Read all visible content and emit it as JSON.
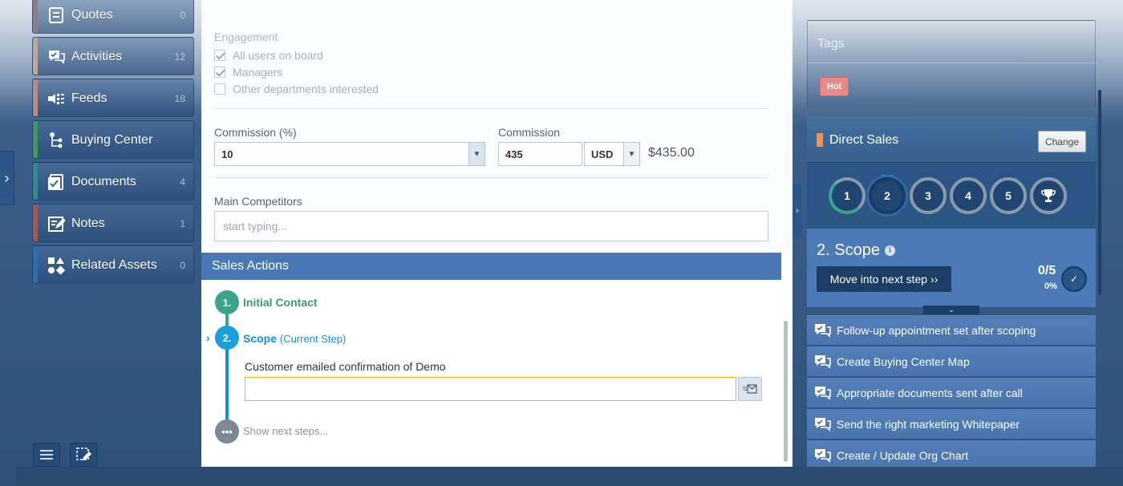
{
  "sidebar": {
    "items": [
      {
        "label": "Quotes",
        "count": "0",
        "accent": "#8b7f86"
      },
      {
        "label": "Activities",
        "count": "12",
        "accent": "#c0a59b"
      },
      {
        "label": "Feeds",
        "count": "18",
        "accent": "#b98b7d"
      },
      {
        "label": "Buying Center",
        "count": "",
        "accent": "#3d9a5f"
      },
      {
        "label": "Documents",
        "count": "4",
        "accent": "#2f8a93"
      },
      {
        "label": "Notes",
        "count": "1",
        "accent": "#a15a4e"
      },
      {
        "label": "Related Assets",
        "count": "0",
        "accent": "#2f6db0"
      }
    ]
  },
  "engagement": {
    "title": "Engagement",
    "options": [
      {
        "label": "All users on board",
        "checked": true
      },
      {
        "label": "Managers",
        "checked": true
      },
      {
        "label": "Other departments interested",
        "checked": false
      }
    ]
  },
  "commission": {
    "percent_label": "Commission (%)",
    "percent_value": "10",
    "amount_label": "Commission",
    "amount_value": "435",
    "currency": "USD",
    "amount_display": "$435.00"
  },
  "competitors": {
    "label": "Main Competitors",
    "placeholder": "start typing..."
  },
  "sales_actions": {
    "title": "Sales Actions",
    "steps": [
      {
        "number": "1.",
        "title": "Initial Contact",
        "sub": ""
      },
      {
        "number": "2.",
        "title": "Scope",
        "sub": "(Current Step)"
      }
    ],
    "task_label": "Customer emailed confirmation of Demo",
    "next_steps_label": "Show next steps..."
  },
  "tags": {
    "title": "Tags",
    "items": [
      "Hot"
    ]
  },
  "process": {
    "title": "Direct Sales",
    "change_label": "Change",
    "steps": [
      "1",
      "2",
      "3",
      "4",
      "5"
    ],
    "current_step_title": "2. Scope",
    "move_label": "Move into next step ››",
    "progress_fraction": "0/5",
    "progress_percent": "0%",
    "tasks": [
      "Follow-up appointment set after scoping",
      "Create Buying Center Map",
      "Appropriate documents sent after call",
      "Send the right marketing Whitepaper",
      "Create / Update Org Chart"
    ]
  },
  "colors": {
    "accent_blue": "#4a78b4",
    "done_green": "#3aa58a",
    "current_blue": "#1aa0de",
    "tag_hot": "#e58a86"
  }
}
